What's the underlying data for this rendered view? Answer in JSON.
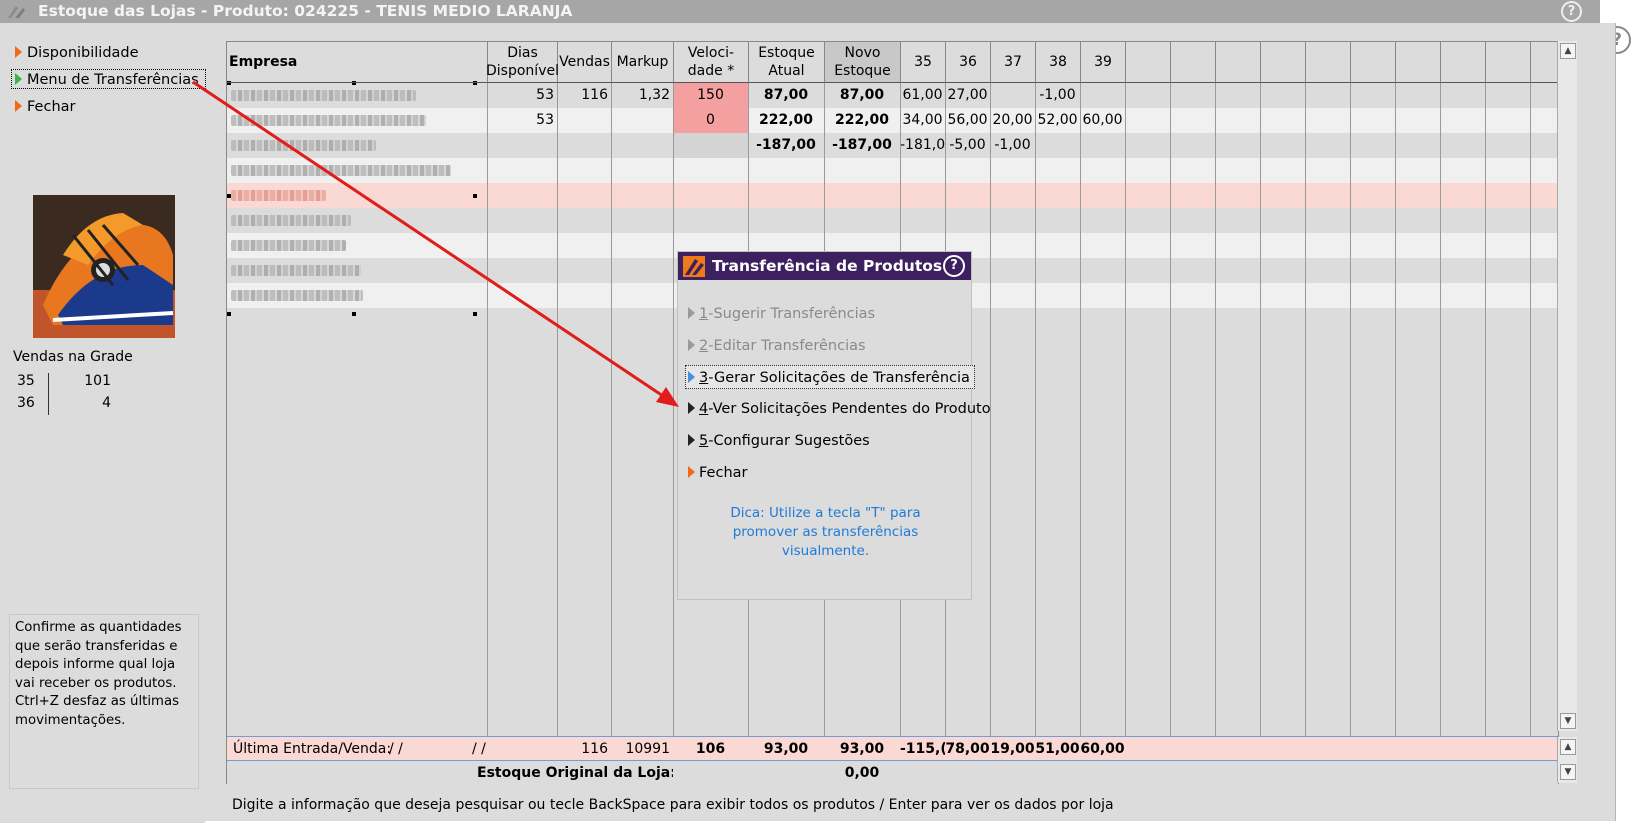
{
  "window": {
    "title": "Estoque das Lojas - Produto: 024225 - TENIS MEDIO LARANJA",
    "help_glyph": "?"
  },
  "sidebar": {
    "items": [
      {
        "label": "Disponibilidade",
        "icon": "orange-triangle-icon"
      },
      {
        "label": "Menu de Transferências",
        "icon": "green-triangle-icon",
        "selected": true
      },
      {
        "label": "Fechar",
        "icon": "orange-triangle-icon"
      }
    ],
    "product_image": "sneaker-photo",
    "grade_label": "Vendas na Grade",
    "grade": [
      {
        "size": "35",
        "qty": "101"
      },
      {
        "size": "36",
        "qty": "4"
      }
    ],
    "hint_lines": [
      "Confirme as quantidades",
      "que serão transferidas e",
      "depois informe qual loja",
      "vai receber os produtos.",
      "Ctrl+Z desfaz as últimas",
      "movimentações."
    ]
  },
  "table": {
    "headers": {
      "empresa": "Empresa",
      "dias_1": "Dias",
      "dias_2": "Disponível",
      "vendas": "Vendas",
      "markup": "Markup",
      "veloc_1": "Veloci-",
      "veloc_2": "dade *",
      "estoque_1": "Estoque",
      "estoque_2": "Atual",
      "novo_1": "Novo",
      "novo_2": "Estoque",
      "s35": "35",
      "s36": "36",
      "s37": "37",
      "s38": "38",
      "s39": "39"
    },
    "rows": [
      {
        "dias": "53",
        "vendas": "116",
        "markup": "1,32",
        "veloc": "150",
        "estoque": "87,00",
        "novo": "87,00",
        "s35": "61,00",
        "s36": "27,00",
        "s37": "",
        "s38": "-1,00",
        "s39": ""
      },
      {
        "dias": "53",
        "vendas": "",
        "markup": "",
        "veloc": "0",
        "estoque": "222,00",
        "novo": "222,00",
        "s35": "34,00",
        "s36": "56,00",
        "s37": "20,00",
        "s38": "52,00",
        "s39": "60,00"
      },
      {
        "dias": "",
        "vendas": "",
        "markup": "",
        "veloc": "",
        "estoque": "-187,00",
        "novo": "-187,00",
        "s35": "-181,0",
        "s36": "-5,00",
        "s37": "-1,00",
        "s38": "",
        "s39": ""
      }
    ],
    "footer": {
      "label": "Última Entrada/Venda:",
      "date1": "/ /",
      "date2": "/ /",
      "vendas": "116",
      "markup": "10991",
      "veloc": "106",
      "estoque": "93,00",
      "novo": "93,00",
      "s35": "-115,(",
      "s36": "78,00",
      "s37": "19,00",
      "s38": "51,00",
      "s39": "60,00",
      "original_label": "Estoque Original da Loja:",
      "original_value": "0,00"
    }
  },
  "dialog": {
    "title": "Transferência de Produtos",
    "help_glyph": "?",
    "items": [
      {
        "key": "1",
        "label": "-Sugerir Transferências",
        "state": "disabled"
      },
      {
        "key": "2",
        "label": "-Editar Transferências",
        "state": "disabled"
      },
      {
        "key": "3",
        "label": "-Gerar Solicitações de Transferência",
        "state": "focused"
      },
      {
        "key": "4",
        "label": "-Ver Solicitações Pendentes do Produto",
        "state": "enabled"
      },
      {
        "key": "5",
        "label": "-Configurar Sugestões",
        "state": "enabled"
      },
      {
        "key": "",
        "label": "Fechar",
        "state": "enabled"
      }
    ],
    "tip_lines": [
      "Dica: Utilize a tecla \"T\" para",
      "promover as transferências",
      "visualmente."
    ]
  },
  "status_bar": "Digite a informação que deseja pesquisar ou tecle BackSpace para exibir todos os produtos / Enter para ver os dados por loja",
  "colors": {
    "title_bg": "#a6a6a6",
    "dialog_header": "#3c205f",
    "highlight_pink": "#fad8d3",
    "velocity_red": "#f4a0a0",
    "tip_blue": "#1e7ad7",
    "arrow_red": "#e21b1b"
  }
}
